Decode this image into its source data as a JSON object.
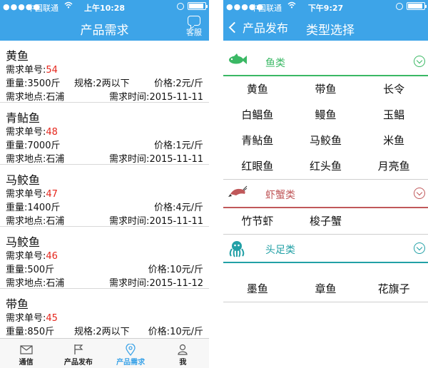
{
  "left": {
    "status": {
      "signal": "●●●●●",
      "carrier": "中国联通",
      "time": "上午10:28"
    },
    "nav": {
      "title": "产品需求",
      "service_label": "客服"
    },
    "labels": {
      "order_no": "需求单号:",
      "weight": "重量:",
      "spec": "规格:",
      "price": "价格:",
      "location": "需求地点:",
      "time": "需求时间:"
    },
    "items": [
      {
        "name": "黄鱼",
        "order_no": "54",
        "weight": "3500斤",
        "spec": "2两以下",
        "price": "2元/斤",
        "location": "石浦",
        "time": "2015-11-11"
      },
      {
        "name": "青鲇鱼",
        "order_no": "48",
        "weight": "7000斤",
        "spec": "",
        "price": "1元/斤",
        "location": "石浦",
        "time": "2015-11-11"
      },
      {
        "name": "马鲛鱼",
        "order_no": "47",
        "weight": "1400斤",
        "spec": "",
        "price": "4元/斤",
        "location": "石浦",
        "time": "2015-11-11"
      },
      {
        "name": "马鲛鱼",
        "order_no": "46",
        "weight": "500斤",
        "spec": "",
        "price": "10元/斤",
        "location": "石浦",
        "time": "2015-11-12"
      },
      {
        "name": "带鱼",
        "order_no": "45",
        "weight": "850斤",
        "spec": "2两以下",
        "price": "10元/斤"
      }
    ],
    "tabs": [
      {
        "label": "通信",
        "icon": "mail-icon"
      },
      {
        "label": "产品发布",
        "icon": "flag-icon"
      },
      {
        "label": "产品需求",
        "icon": "location-pin-icon"
      },
      {
        "label": "我",
        "icon": "person-icon"
      }
    ],
    "colors": {
      "accent": "#3da4e8",
      "order_no": "#e5261c"
    }
  },
  "right": {
    "status": {
      "signal": "●●●●●",
      "carrier": "中国联通",
      "time": "下午9:27"
    },
    "nav": {
      "back_label": "产品发布",
      "title": "类型选择"
    },
    "sections": [
      {
        "label": "鱼类",
        "icon": "fish-icon",
        "color": "#3ab864",
        "items": [
          "黄鱼",
          "带鱼",
          "长令",
          "白鲳鱼",
          "鳗鱼",
          "玉鲳",
          "青鲇鱼",
          "马鲛鱼",
          "米鱼",
          "红眼鱼",
          "红头鱼",
          "月亮鱼"
        ]
      },
      {
        "label": "虾蟹类",
        "icon": "shrimp-icon",
        "color": "#c0585a",
        "items": [
          "竹节虾",
          "梭子蟹"
        ]
      },
      {
        "label": "头足类",
        "icon": "octopus-icon",
        "color": "#22a0a6",
        "items": [
          "墨鱼",
          "章鱼",
          "花旗子"
        ]
      }
    ]
  }
}
